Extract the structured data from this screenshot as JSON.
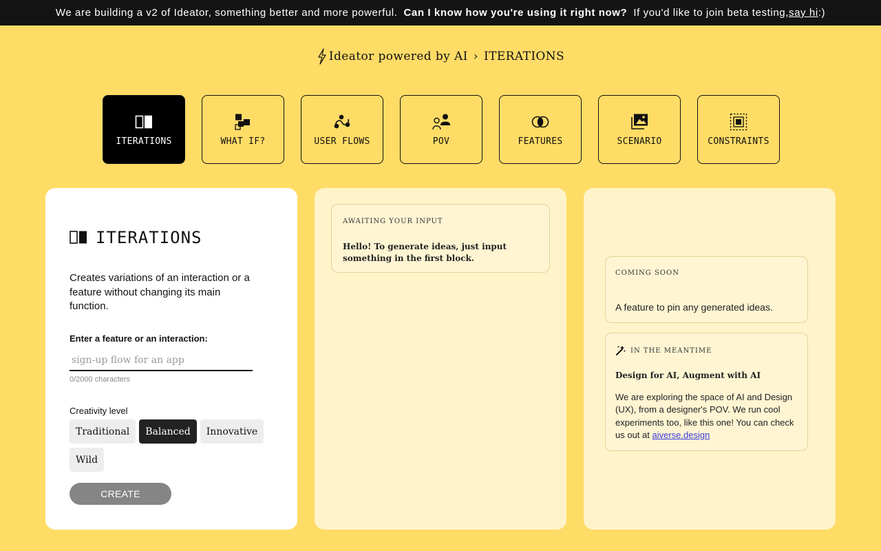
{
  "banner": {
    "text_before": "We are building a v2 of Ideator, something better and more powerful.",
    "bold_question": "Can I know how you're using it right now?",
    "text_after": "If you'd like to join beta testing,",
    "link_label": "say hi",
    "suffix": ":)"
  },
  "breadcrumb": {
    "app_name": "Ideator powered by AI",
    "separator": "›",
    "current": "ITERATIONS"
  },
  "tabs": [
    {
      "label": "ITERATIONS",
      "icon": "iterations-icon",
      "active": true
    },
    {
      "label": "WHAT IF?",
      "icon": "what-if-icon",
      "active": false
    },
    {
      "label": "USER FLOWS",
      "icon": "user-flows-icon",
      "active": false
    },
    {
      "label": "POV",
      "icon": "pov-icon",
      "active": false
    },
    {
      "label": "FEATURES",
      "icon": "features-icon",
      "active": false
    },
    {
      "label": "SCENARIO",
      "icon": "scenario-icon",
      "active": false
    },
    {
      "label": "CONSTRAINTS",
      "icon": "constraints-icon",
      "active": false
    }
  ],
  "input_panel": {
    "title": "ITERATIONS",
    "description": "Creates variations of an interaction or a feature without changing its main function.",
    "field_label": "Enter a feature or an interaction:",
    "field_placeholder": "sign-up flow for an app",
    "field_value": "",
    "char_count": "0/2000 characters",
    "creativity_label": "Creativity level",
    "creativity_levels": [
      {
        "label": "Traditional",
        "active": false
      },
      {
        "label": "Balanced",
        "active": true
      },
      {
        "label": "Innovative",
        "active": false
      },
      {
        "label": "Wild",
        "active": false
      }
    ],
    "create_label": "CREATE"
  },
  "output_panel": {
    "status_label": "AWAITING YOUR INPUT",
    "message": "Hello! To generate ideas, just input something in the first block."
  },
  "side_panel": {
    "coming_soon_label": "COMING SOON",
    "coming_soon_text": "A feature to pin any generated ideas.",
    "meantime_label": "IN THE MEANTIME",
    "meantime_icon": "magic-wand-icon",
    "meantime_title": "Design for AI, Augment with AI",
    "meantime_body": "We are exploring the space of AI and Design (UX), from a designer's POV. We run cool experiments too, like this one! You can check us out at",
    "meantime_link": "aiverse.design"
  },
  "colors": {
    "background": "#ffdc66",
    "banner": "#141414",
    "active_tab": "#000000",
    "card_background": "#fff3c9",
    "create_button": "#858585",
    "link": "#3a3ae0"
  }
}
